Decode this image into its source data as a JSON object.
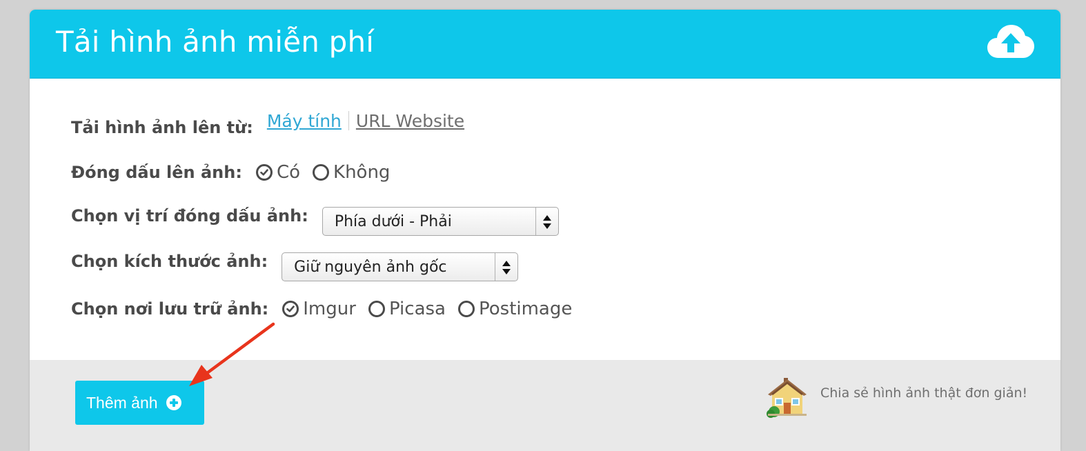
{
  "header": {
    "title": "Tải hình ảnh miễn phí",
    "icon": "cloud-upload-icon"
  },
  "source": {
    "label": "Tải hình ảnh lên từ:",
    "options": [
      {
        "label": "Máy tính",
        "active": true
      },
      {
        "label": "URL Website",
        "active": false
      }
    ]
  },
  "watermark": {
    "label": "Đóng dấu lên ảnh:",
    "options": [
      {
        "label": "Có",
        "checked": true
      },
      {
        "label": "Không",
        "checked": false
      }
    ]
  },
  "position": {
    "label": "Chọn vị trí đóng dấu ảnh:",
    "selected": "Phía dưới - Phải"
  },
  "size": {
    "label": "Chọn kích thước ảnh:",
    "selected": "Giữ nguyên ảnh gốc"
  },
  "storage": {
    "label": "Chọn nơi lưu trữ ảnh:",
    "options": [
      {
        "label": "Imgur",
        "checked": true
      },
      {
        "label": "Picasa",
        "checked": false
      },
      {
        "label": "Postimage",
        "checked": false
      }
    ]
  },
  "footer": {
    "add_button": "Thêm ảnh",
    "tagline": "Chia sẻ hình ảnh thật đơn giản!"
  },
  "colors": {
    "accent": "#0ec7ea",
    "link": "#2fa7d4",
    "annotation_arrow": "#e8341c"
  }
}
